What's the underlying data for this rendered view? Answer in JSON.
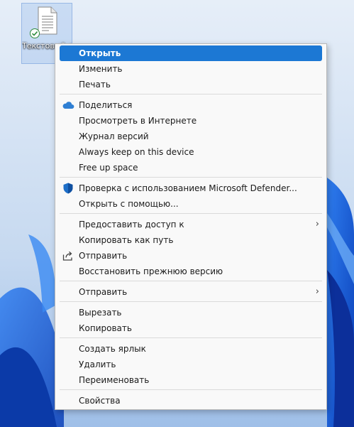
{
  "desktop": {
    "file_icon_caption": "Текстовый документ"
  },
  "menu": {
    "open": "Открыть",
    "edit": "Изменить",
    "print": "Печать",
    "share_onedrive": "Поделиться",
    "view_online": "Просмотреть в Интернете",
    "version_history": "Журнал версий",
    "always_keep": "Always keep on this device",
    "free_up_space": "Free up space",
    "scan_defender": "Проверка с использованием Microsoft Defender...",
    "open_with": "Открыть с помощью...",
    "give_access": "Предоставить доступ к",
    "copy_as_path": "Копировать как путь",
    "share": "Отправить",
    "restore_versions": "Восстановить прежнюю версию",
    "send_to": "Отправить",
    "cut": "Вырезать",
    "copy": "Копировать",
    "create_shortcut": "Создать ярлык",
    "delete": "Удалить",
    "rename": "Переименовать",
    "properties": "Свойства"
  },
  "icons": {
    "onedrive": "cloud-icon",
    "defender": "shield-icon",
    "share": "share-icon",
    "submenu": "chevron-right-icon"
  },
  "colors": {
    "highlight": "#1c78d4",
    "onedrive": "#2f7fd3",
    "defender": "#1e6fc8"
  }
}
